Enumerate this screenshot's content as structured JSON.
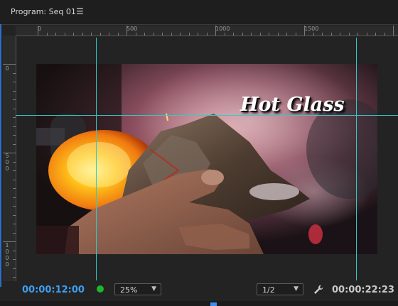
{
  "panel": {
    "title": "Program: Seq 01",
    "menu_icon": "hamburger-icon"
  },
  "ruler_top": {
    "labels": [
      "0",
      "500",
      "1000",
      "1500"
    ]
  },
  "ruler_left": {
    "labels": [
      [
        "0"
      ],
      [
        "5",
        "0",
        "0"
      ],
      [
        "1",
        "0",
        "0",
        "0"
      ]
    ]
  },
  "video": {
    "title_overlay": "Hot Glass",
    "scene": "hands-holding-burning-wood-glass-glow"
  },
  "footer": {
    "timecode_current": "00:00:12:00",
    "zoom_value": "25%",
    "resolution_value": "1/2",
    "timecode_duration": "00:00:22:23",
    "status_color": "#1fb52a",
    "wrench_icon": "wrench-icon"
  },
  "colors": {
    "accent_blue": "#3e9ef0",
    "guide_cyan": "#33c9c9"
  }
}
